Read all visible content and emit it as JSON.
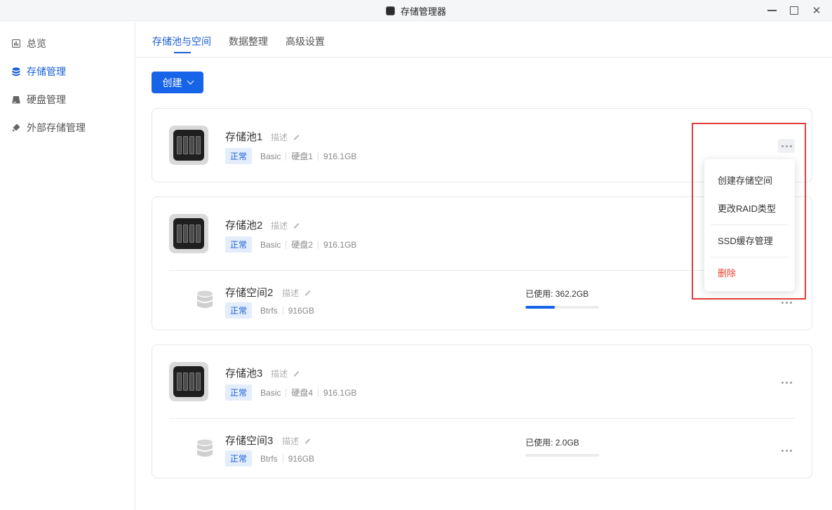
{
  "window": {
    "title": "存储管理器"
  },
  "sidebar": {
    "items": [
      {
        "label": "总览",
        "icon": "overview-icon"
      },
      {
        "label": "存储管理",
        "icon": "database-icon",
        "active": true
      },
      {
        "label": "硬盘管理",
        "icon": "disk-icon"
      },
      {
        "label": "外部存储管理",
        "icon": "usb-icon"
      }
    ]
  },
  "tabs": [
    {
      "label": "存储池与空间",
      "active": true
    },
    {
      "label": "数据整理"
    },
    {
      "label": "高级设置"
    }
  ],
  "toolbar": {
    "create_label": "创建"
  },
  "pools": [
    {
      "name": "存储池1",
      "desc": "描述",
      "status": "正常",
      "raid": "Basic",
      "disk": "硬盘1",
      "size": "916.1GB",
      "volumes": []
    },
    {
      "name": "存储池2",
      "desc": "描述",
      "status": "正常",
      "raid": "Basic",
      "disk": "硬盘2",
      "size": "916.1GB",
      "volumes": [
        {
          "name": "存储空间2",
          "desc": "描述",
          "status": "正常",
          "fs": "Btrfs",
          "size": "916GB",
          "used_label": "已使用: 362.2GB",
          "used_fraction": 0.4
        }
      ]
    },
    {
      "name": "存储池3",
      "desc": "描述",
      "status": "正常",
      "raid": "Basic",
      "disk": "硬盘4",
      "size": "916.1GB",
      "volumes": [
        {
          "name": "存储空间3",
          "desc": "描述",
          "status": "正常",
          "fs": "Btrfs",
          "size": "916GB",
          "used_label": "已使用: 2.0GB",
          "used_fraction": 0.0
        }
      ]
    }
  ],
  "menu": {
    "items": [
      {
        "label": "创建存储空间"
      },
      {
        "label": "更改RAID类型"
      },
      {
        "label": "SSD缓存管理"
      },
      {
        "label": "删除",
        "danger": true
      }
    ]
  },
  "colors": {
    "accent": "#1764e8",
    "danger": "#e5432f",
    "highlight": "#e03a3a"
  }
}
